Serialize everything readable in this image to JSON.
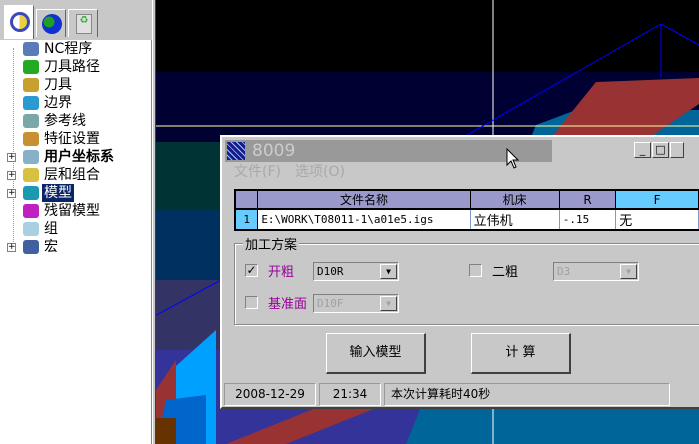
{
  "sidebar": {
    "tabs": [
      {
        "icon": "nc-program-icon"
      },
      {
        "icon": "globe-icon"
      },
      {
        "icon": "recycle-bin-icon"
      }
    ],
    "items": [
      {
        "label": "NC程序",
        "expandable": false,
        "bold": false,
        "color": "#5a7ab8"
      },
      {
        "label": "刀具路径",
        "expandable": false,
        "bold": false,
        "color": "#22aa22"
      },
      {
        "label": "刀具",
        "expandable": false,
        "bold": false,
        "color": "#c8a030"
      },
      {
        "label": "边界",
        "expandable": false,
        "bold": false,
        "color": "#2a9ad0"
      },
      {
        "label": "参考线",
        "expandable": false,
        "bold": false,
        "color": "#7aa8a8"
      },
      {
        "label": "特征设置",
        "expandable": false,
        "bold": false,
        "color": "#c89030"
      },
      {
        "label": "用户坐标系",
        "expandable": true,
        "bold": true,
        "color": "#88b0c8"
      },
      {
        "label": "层和组合",
        "expandable": true,
        "bold": false,
        "color": "#d8c040"
      },
      {
        "label": "模型",
        "expandable": true,
        "bold": false,
        "selected": true,
        "color": "#1a9ab0"
      },
      {
        "label": "残留模型",
        "expandable": false,
        "bold": false,
        "color": "#c020c0"
      },
      {
        "label": "组",
        "expandable": false,
        "bold": false,
        "color": "#a8d0e0"
      },
      {
        "label": "宏",
        "expandable": true,
        "bold": false,
        "color": "#4060a0"
      }
    ]
  },
  "dialog": {
    "title": "8009",
    "menu": [
      "文件(F)",
      "选项(O)"
    ],
    "table": {
      "headers": [
        "",
        "文件名称",
        "机床",
        "R",
        "F"
      ],
      "rows": [
        [
          "1",
          "E:\\WORK\\T08011-1\\a01e5.igs",
          "立伟机",
          "-.15",
          "无"
        ]
      ]
    },
    "group": {
      "title": "加工方案",
      "options": [
        {
          "label": "开粗",
          "checked": true,
          "value": "D10R",
          "enabled": true
        },
        {
          "label": "二粗",
          "checked": false,
          "value": "D3",
          "enabled": false
        },
        {
          "label": "基准面",
          "checked": false,
          "value": "D10F",
          "enabled": false
        }
      ]
    },
    "buttons": {
      "import": "输入模型",
      "compute": "计  算"
    },
    "status": {
      "date": "2008-12-29",
      "time": "21:34",
      "message": "本次计算耗时40秒"
    }
  },
  "colors": {
    "accent_label": "#990099",
    "selection": "#0a246a"
  }
}
